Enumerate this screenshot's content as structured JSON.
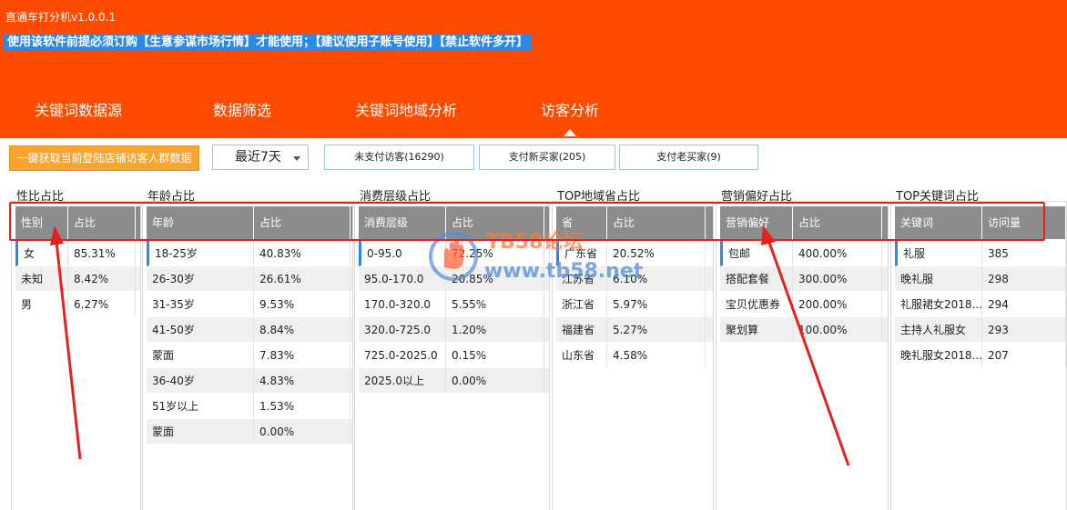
{
  "app": {
    "title": "直通车打分机v1.0.0.1",
    "notice": "使用该软件前提必须订购【生意参谋市场行情】才能使用；【建议使用子账号使用】【禁止软件多开】"
  },
  "tabs": [
    {
      "label": "关键词数据源"
    },
    {
      "label": "数据筛选"
    },
    {
      "label": "关键词地域分析"
    },
    {
      "label": "访客分析"
    }
  ],
  "toolbar": {
    "fetch_label": "一键获取当前登陆店铺访客人群数据",
    "period_value": "最近7天",
    "unpaid_label": "未支付访客(16290)",
    "new_buyer_label": "支付新买家(205)",
    "old_buyer_label": "支付老买家(9)"
  },
  "panels": [
    {
      "title": "性比占比",
      "headers": [
        "性别",
        "占比"
      ],
      "rows": [
        [
          "女",
          "85.31%"
        ],
        [
          "未知",
          "8.42%"
        ],
        [
          "男",
          "6.27%"
        ]
      ]
    },
    {
      "title": "年龄占比",
      "headers": [
        "年龄",
        "占比"
      ],
      "rows": [
        [
          "18-25岁",
          "40.83%"
        ],
        [
          "26-30岁",
          "26.61%"
        ],
        [
          "31-35岁",
          "9.53%"
        ],
        [
          "41-50岁",
          "8.84%"
        ],
        [
          "蒙面",
          "7.83%"
        ],
        [
          "36-40岁",
          "4.83%"
        ],
        [
          "51岁以上",
          "1.53%"
        ],
        [
          "蒙面",
          "0.00%"
        ]
      ]
    },
    {
      "title": "消费层级占比",
      "headers": [
        "消费层级",
        "占比"
      ],
      "rows": [
        [
          "0-95.0",
          "72.25%"
        ],
        [
          "95.0-170.0",
          "20.85%"
        ],
        [
          "170.0-320.0",
          "5.55%"
        ],
        [
          "320.0-725.0",
          "1.20%"
        ],
        [
          "725.0-2025.0",
          "0.15%"
        ],
        [
          "2025.0以上",
          "0.00%"
        ]
      ]
    },
    {
      "title": "TOP地域省占比",
      "headers": [
        "省",
        "占比"
      ],
      "rows": [
        [
          "广东省",
          "20.52%"
        ],
        [
          "江苏省",
          "6.10%"
        ],
        [
          "浙江省",
          "5.97%"
        ],
        [
          "福建省",
          "5.27%"
        ],
        [
          "山东省",
          "4.58%"
        ]
      ]
    },
    {
      "title": "营销偏好占比",
      "headers": [
        "营销偏好",
        "占比"
      ],
      "rows": [
        [
          "包邮",
          "400.00%"
        ],
        [
          "搭配套餐",
          "300.00%"
        ],
        [
          "宝贝优惠券",
          "200.00%"
        ],
        [
          "聚划算",
          "100.00%"
        ]
      ]
    },
    {
      "title": "TOP关键词占比",
      "headers": [
        "关键词",
        "访问量"
      ],
      "rows": [
        [
          "礼服",
          "385"
        ],
        [
          "晚礼服",
          "298"
        ],
        [
          "礼服裙女2018...",
          "294"
        ],
        [
          "主持人礼服女",
          "293"
        ],
        [
          "晚礼服女2018...",
          "207"
        ]
      ]
    }
  ],
  "watermark": {
    "line1": "TB58论坛",
    "line2": "www.tb58.net"
  },
  "colors": {
    "header_bg": "#ff4a02",
    "notice_bg": "#2b8ae9",
    "fetch_btn": "#f6a531",
    "table_header": "#8c8c8c",
    "annotation": "#e6201c"
  }
}
